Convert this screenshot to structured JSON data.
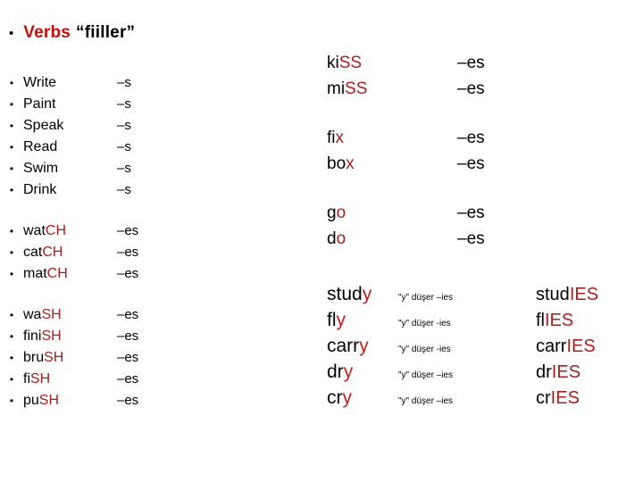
{
  "slide": {
    "title": {
      "bullet": "•",
      "main": "Verbs",
      "sub": "“fiiller”"
    }
  },
  "left_column": {
    "groups": [
      {
        "name": "plain-s-verbs",
        "rows": [
          {
            "bullet": "•",
            "stem": "Write",
            "highlight": "",
            "suffix": "–s"
          },
          {
            "bullet": "•",
            "stem": "Paint",
            "highlight": "",
            "suffix": "–s"
          },
          {
            "bullet": "•",
            "stem": "Speak",
            "highlight": "",
            "suffix": "–s"
          },
          {
            "bullet": "•",
            "stem": "Read",
            "highlight": "",
            "suffix": "–s"
          },
          {
            "bullet": "•",
            "stem": "Swim",
            "highlight": "",
            "suffix": "–s"
          },
          {
            "bullet": "•",
            "stem": "Drink",
            "highlight": "",
            "suffix": "–s"
          }
        ]
      },
      {
        "name": "ch-verbs",
        "rows": [
          {
            "bullet": "•",
            "stem": "wat",
            "highlight": "CH",
            "suffix": "–es"
          },
          {
            "bullet": "•",
            "stem": "cat",
            "highlight": "CH",
            "suffix": "–es"
          },
          {
            "bullet": "•",
            "stem": "mat",
            "highlight": "CH",
            "suffix": "–es"
          }
        ]
      },
      {
        "name": "sh-verbs",
        "rows": [
          {
            "bullet": "•",
            "stem": "wa",
            "highlight": "SH",
            "suffix": "–es"
          },
          {
            "bullet": "•",
            "stem": "fini",
            "highlight": "SH",
            "suffix": "–es"
          },
          {
            "bullet": "•",
            "stem": "bru",
            "highlight": "SH",
            "suffix": "–es"
          },
          {
            "bullet": "•",
            "stem": "fi",
            "highlight": "SH",
            "suffix": "–es"
          },
          {
            "bullet": "•",
            "stem": "pu",
            "highlight": "SH",
            "suffix": "–es"
          }
        ]
      }
    ]
  },
  "right_column": {
    "groups": [
      {
        "name": "ss-verbs",
        "rows": [
          {
            "stem": "ki",
            "highlight": "SS",
            "suffix": "–es"
          },
          {
            "stem": "mi",
            "highlight": "SS",
            "suffix": "–es"
          }
        ]
      },
      {
        "name": "x-verbs",
        "rows": [
          {
            "stem": "fi",
            "highlight": "x",
            "suffix": "–es"
          },
          {
            "stem": "bo",
            "highlight": "x",
            "suffix": "–es"
          }
        ]
      },
      {
        "name": "o-verbs",
        "rows": [
          {
            "stem": "g",
            "highlight": "o",
            "suffix": "–es"
          },
          {
            "stem": "d",
            "highlight": "o",
            "suffix": "–es"
          }
        ]
      }
    ]
  },
  "y_group": {
    "name": "y-to-ies-verbs",
    "rows": [
      {
        "stem": "stud",
        "highlight": "y",
        "note": "\"y\" düşer –ies",
        "plural_stem": "stud",
        "plural_highlight": "IES"
      },
      {
        "stem": "fl",
        "highlight": "y",
        "note": "\"y\" düşer -ies",
        "plural_stem": "fl",
        "plural_highlight": "IES"
      },
      {
        "stem": "carr",
        "highlight": "y",
        "note": "\"y\" düşer -ies",
        "plural_stem": "carr",
        "plural_highlight": "IES"
      },
      {
        "stem": "dr",
        "highlight": "y",
        "note": "\"y\" düşer –ies",
        "plural_stem": "dr",
        "plural_highlight": "IES"
      },
      {
        "stem": "cr",
        "highlight": "y",
        "note": "\"y\" düşer –ies",
        "plural_stem": "cr",
        "plural_highlight": "IES"
      }
    ]
  },
  "colors": {
    "title_red": "#cc0b0b",
    "body_red": "#a81f1f",
    "text_black": "#000000",
    "background": "#ffffff"
  }
}
